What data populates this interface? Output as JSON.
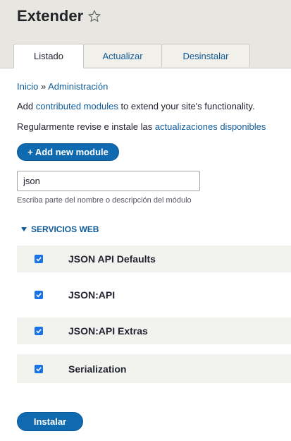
{
  "header": {
    "title": "Extender",
    "tabs": [
      {
        "label": "Listado"
      },
      {
        "label": "Actualizar"
      },
      {
        "label": "Desinstalar"
      }
    ]
  },
  "breadcrumb": {
    "home": "Inicio",
    "separator": "»",
    "admin": "Administración"
  },
  "intro": {
    "line1_prefix": "Add ",
    "line1_link": "contributed modules",
    "line1_suffix": " to extend your site's functionality.",
    "line2_prefix": "Regularmente revise e instale las ",
    "line2_link": "actualizaciones disponibles"
  },
  "add_button": {
    "label": "+ Add new module"
  },
  "search": {
    "value": "json",
    "hint": "Escriba parte del nombre o descripción del módulo"
  },
  "section": {
    "title": "SERVICIOS WEB"
  },
  "modules": [
    {
      "name": "JSON API Defaults",
      "checked": true
    },
    {
      "name": "JSON:API",
      "checked": true
    },
    {
      "name": "JSON:API Extras",
      "checked": true
    },
    {
      "name": "Serialization",
      "checked": true
    }
  ],
  "install_button": {
    "label": "Instalar"
  },
  "colors": {
    "link": "#0f5b9a",
    "button": "#0f6ab0",
    "checkbox": "#1a73e8"
  }
}
